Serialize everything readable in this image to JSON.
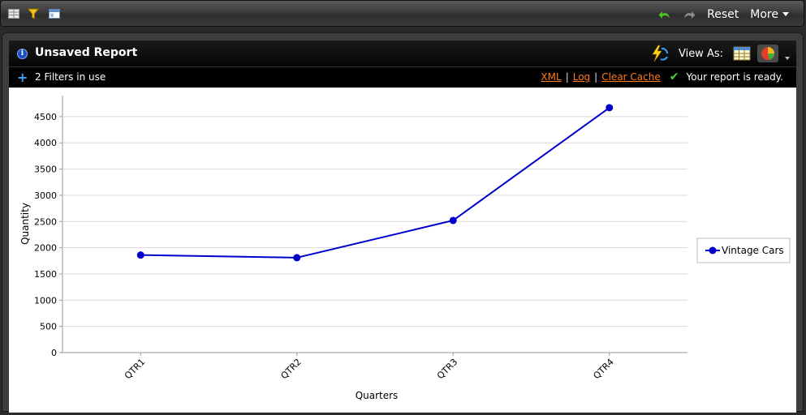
{
  "toolbar": {
    "icons": [
      "grid-icon",
      "filter-icon",
      "layout-icon",
      "undo-icon",
      "redo-icon"
    ],
    "reset_label": "Reset",
    "more_label": "More"
  },
  "report": {
    "title": "Unsaved Report",
    "view_as_label": "View As:",
    "filters_text": "2 Filters in use",
    "links": {
      "xml": "XML",
      "log": "Log",
      "clear_cache": "Clear Cache"
    },
    "status": "Your report is ready."
  },
  "chart_data": {
    "type": "line",
    "categories": [
      "QTR1",
      "QTR2",
      "QTR3",
      "QTR4"
    ],
    "series": [
      {
        "name": "Vintage Cars",
        "values": [
          1860,
          1810,
          2520,
          4670
        ],
        "color": "#0000cc"
      }
    ],
    "title": "",
    "xlabel": "Quarters",
    "ylabel": "Quantity",
    "ylim": [
      0,
      4900
    ],
    "yticks": [
      0,
      500,
      1000,
      1500,
      2000,
      2500,
      3000,
      3500,
      4000,
      4500
    ],
    "grid": true,
    "legend": "right"
  }
}
